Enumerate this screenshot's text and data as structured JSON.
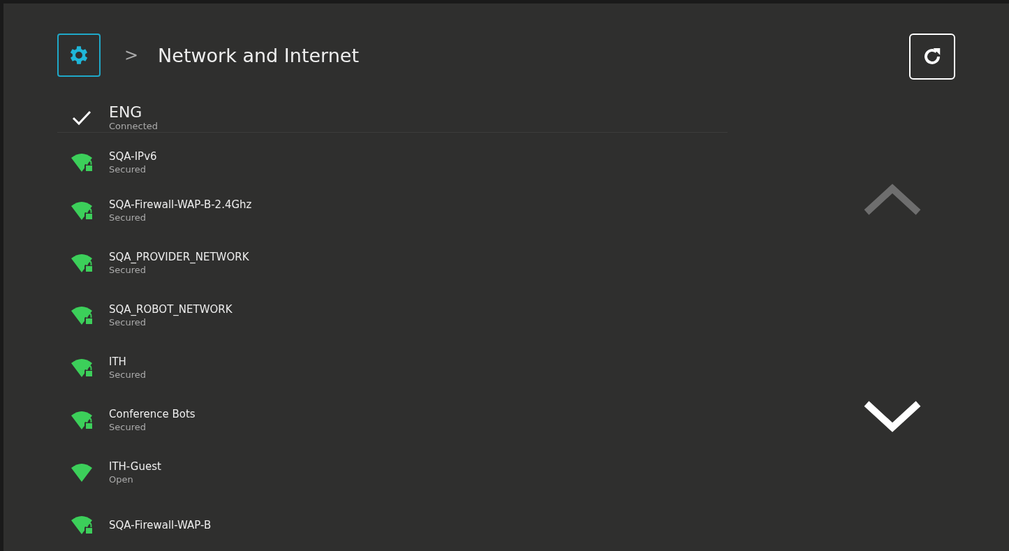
{
  "header": {
    "breadcrumb_separator": ">",
    "title": "Network and Internet"
  },
  "connected": {
    "name": "ENG",
    "status": "Connected",
    "checked": true
  },
  "networks": [
    {
      "name": "SQA-IPv6",
      "status": "Secured",
      "kind": "secured"
    },
    {
      "name": "SQA-Firewall-WAP-B-2.4Ghz",
      "status": "Secured",
      "kind": "secured"
    },
    {
      "name": "SQA_PROVIDER_NETWORK",
      "status": "Secured",
      "kind": "secured"
    },
    {
      "name": "SQA_ROBOT_NETWORK",
      "status": "Secured",
      "kind": "secured"
    },
    {
      "name": "ITH",
      "status": "Secured",
      "kind": "secured"
    },
    {
      "name": "Conference Bots",
      "status": "Secured",
      "kind": "secured"
    },
    {
      "name": "ITH-Guest",
      "status": "Open",
      "kind": "open"
    },
    {
      "name": "SQA-Firewall-WAP-B",
      "kind": "secured"
    }
  ],
  "scroll": {
    "up_disabled": true,
    "down_disabled": false
  }
}
